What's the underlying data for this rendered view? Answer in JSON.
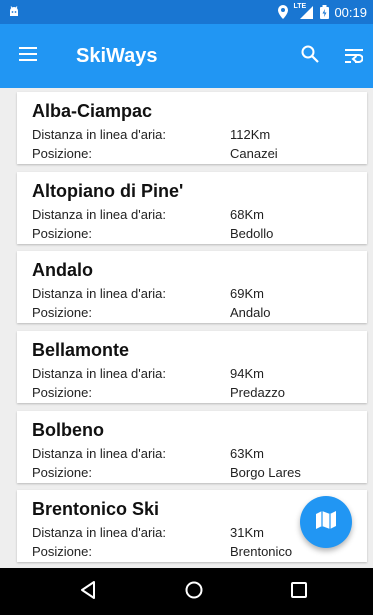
{
  "status_bar": {
    "time": "00:19",
    "network": "LTE"
  },
  "app_bar": {
    "title": "SkiWays"
  },
  "labels": {
    "distance": "Distanza in linea d'aria:",
    "position": "Posizione:"
  },
  "resorts": [
    {
      "name": "Alba-Ciampac",
      "distance": "112Km",
      "position": "Canazei"
    },
    {
      "name": "Altopiano di Pine'",
      "distance": "68Km",
      "position": "Bedollo"
    },
    {
      "name": "Andalo",
      "distance": "69Km",
      "position": "Andalo"
    },
    {
      "name": "Bellamonte",
      "distance": "94Km",
      "position": "Predazzo"
    },
    {
      "name": "Bolbeno",
      "distance": "63Km",
      "position": "Borgo Lares"
    },
    {
      "name": "Brentonico Ski",
      "distance": "31Km",
      "position": "Brentonico"
    }
  ],
  "colors": {
    "status_bar": "#1976d2",
    "app_bar": "#2196f3",
    "fab": "#2196f3",
    "background": "#eeeeee"
  },
  "icons": {
    "menu": "hamburger-menu-icon",
    "search": "search-icon",
    "sort": "sort-icon",
    "fab": "map-icon"
  }
}
